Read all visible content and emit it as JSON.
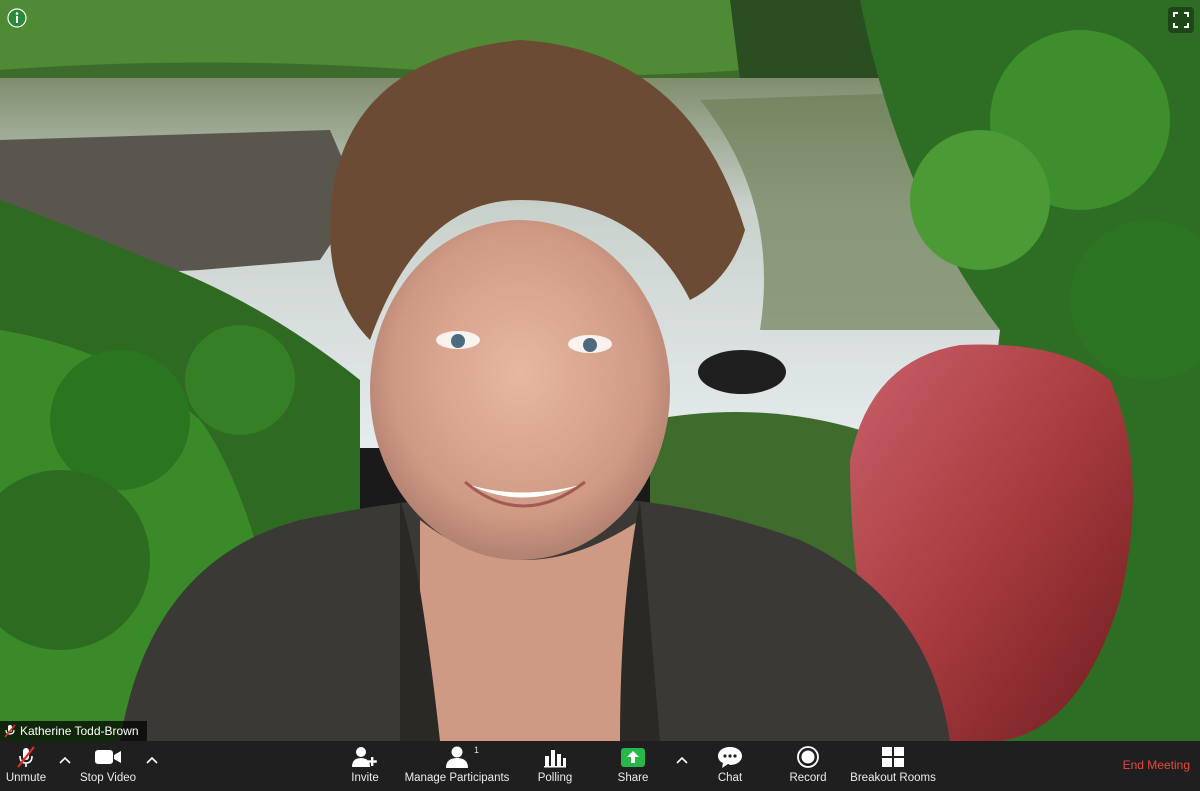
{
  "video": {
    "participant_name": "Katherine Todd-Brown"
  },
  "toolbar": {
    "unmute_label": "Unmute",
    "stop_video_label": "Stop Video",
    "invite_label": "Invite",
    "manage_participants_label": "Manage Participants",
    "participant_count": "1",
    "polling_label": "Polling",
    "share_label": "Share",
    "chat_label": "Chat",
    "record_label": "Record",
    "breakout_rooms_label": "Breakout Rooms",
    "end_meeting_label": "End Meeting"
  },
  "colors": {
    "toolbar_bg": "#1f1f1f",
    "end_meeting": "#e8493f",
    "share_green": "#28b84a",
    "muted_red": "#e02b2b"
  },
  "icons": [
    "info-icon",
    "fullscreen-icon",
    "microphone-muted-icon",
    "video-camera-icon",
    "add-person-icon",
    "participants-icon",
    "bar-chart-icon",
    "share-screen-icon",
    "chat-bubble-icon",
    "record-icon",
    "breakout-grid-icon",
    "chevron-up-icon"
  ]
}
